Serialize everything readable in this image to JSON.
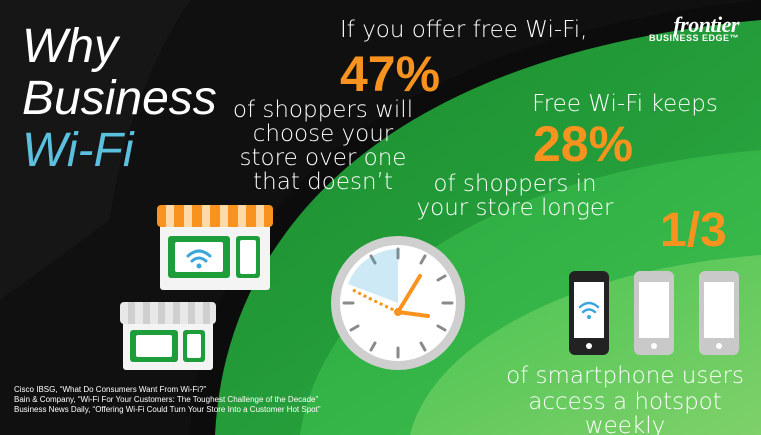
{
  "title": {
    "line1": "Why",
    "line2": "Business",
    "line3": "Wi-Fi"
  },
  "logo": {
    "brand": "frontier",
    "sub": "BUSINESS EDGE™"
  },
  "stat1": {
    "intro": "If you offer free Wi-Fi,",
    "value": "47%",
    "line1": "of shoppers will",
    "line2": "choose your",
    "line3": "store over one",
    "line4": "that doesn’t"
  },
  "stat2": {
    "intro": "Free Wi-Fi keeps",
    "value": "28%",
    "line1": "of shoppers in",
    "line2": "your store longer"
  },
  "stat3": {
    "value": "1/3",
    "line1": "of smartphone users",
    "line2": "access a hotspot weekly"
  },
  "sources": [
    "Cisco IBSG, “What Do Consumers Want From Wi-Fi?”",
    "Bain & Company, “Wi-Fi For Your Customers: The Toughest Challenge of the Decade”",
    "Business News Daily, “Offering Wi-Fi Could Turn Your Store Into a Customer Hot Spot”"
  ],
  "icons": {
    "stores": "store-icon",
    "clock": "clock-icon",
    "phones": "smartphone-icon",
    "wifi": "wifi-icon"
  },
  "colors": {
    "accent": "#f7931e",
    "green_dark": "#1e9e3a",
    "green_light": "#5fc05a",
    "wifi_blue": "#3aa7dc",
    "title_blue": "#5bc0de"
  }
}
